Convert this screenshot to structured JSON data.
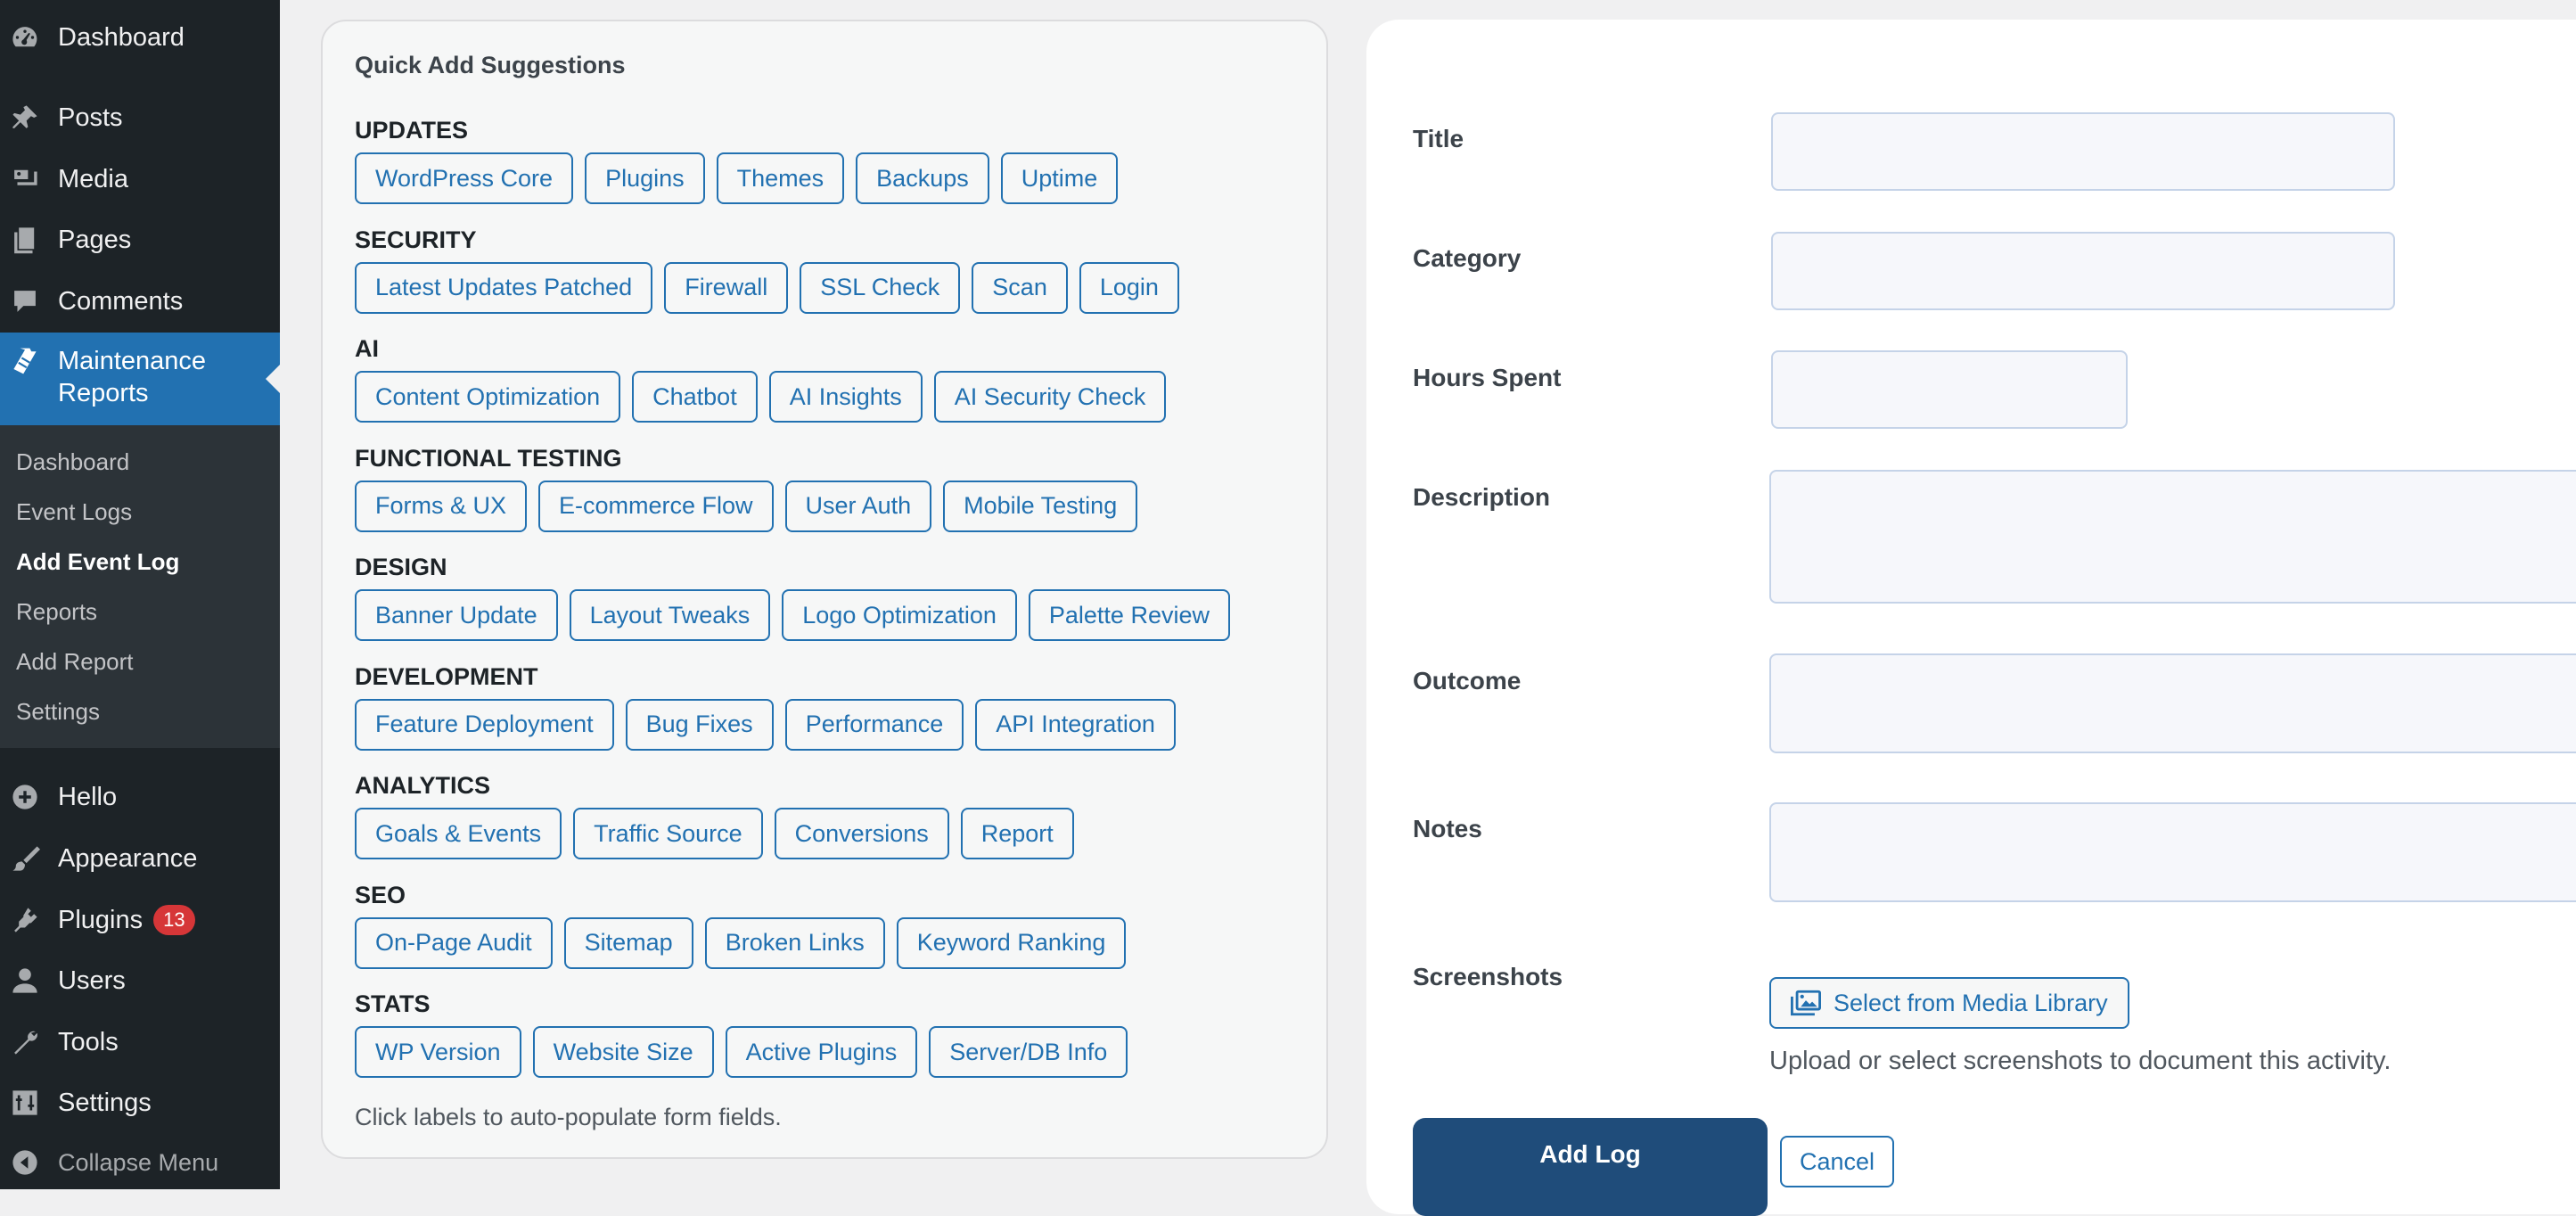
{
  "sidebar": {
    "top_items": [
      {
        "label": "Dashboard",
        "icon": "dashboard-icon"
      },
      {
        "label": "Posts",
        "icon": "pin-icon"
      },
      {
        "label": "Media",
        "icon": "media-icon"
      },
      {
        "label": "Pages",
        "icon": "pages-icon"
      },
      {
        "label": "Comments",
        "icon": "comment-icon"
      }
    ],
    "active_item": {
      "label": "Maintenance Reports",
      "icon": "clipboard-icon"
    },
    "submenu": [
      "Dashboard",
      "Event Logs",
      "Add Event Log",
      "Reports",
      "Add Report",
      "Settings"
    ],
    "submenu_current": "Add Event Log",
    "bottom_items": [
      {
        "label": "Hello",
        "icon": "plus-circle-icon"
      },
      {
        "label": "Appearance",
        "icon": "brush-icon"
      },
      {
        "label": "Plugins",
        "icon": "plugin-icon",
        "badge": "13"
      },
      {
        "label": "Users",
        "icon": "user-icon"
      },
      {
        "label": "Tools",
        "icon": "wrench-icon"
      },
      {
        "label": "Settings",
        "icon": "settings-icon"
      }
    ],
    "collapse_label": "Collapse Menu"
  },
  "quick_add": {
    "title": "Quick Add Suggestions",
    "groups": [
      {
        "label": "UPDATES",
        "chips": [
          "WordPress Core",
          "Plugins",
          "Themes",
          "Backups",
          "Uptime"
        ]
      },
      {
        "label": "SECURITY",
        "chips": [
          "Latest Updates Patched",
          "Firewall",
          "SSL Check",
          "Scan",
          "Login"
        ]
      },
      {
        "label": "AI",
        "chips": [
          "Content Optimization",
          "Chatbot",
          "AI Insights",
          "AI Security Check"
        ]
      },
      {
        "label": "FUNCTIONAL TESTING",
        "chips": [
          "Forms & UX",
          "E-commerce Flow",
          "User Auth",
          "Mobile Testing"
        ]
      },
      {
        "label": "DESIGN",
        "chips": [
          "Banner Update",
          "Layout Tweaks",
          "Logo Optimization",
          "Palette Review"
        ]
      },
      {
        "label": "DEVELOPMENT",
        "chips": [
          "Feature Deployment",
          "Bug Fixes",
          "Performance",
          "API Integration"
        ]
      },
      {
        "label": "ANALYTICS",
        "chips": [
          "Goals & Events",
          "Traffic Source",
          "Conversions",
          "Report"
        ]
      },
      {
        "label": "SEO",
        "chips": [
          "On-Page Audit",
          "Sitemap",
          "Broken Links",
          "Keyword Ranking"
        ]
      },
      {
        "label": "STATS",
        "chips": [
          "WP Version",
          "Website Size",
          "Active Plugins",
          "Server/DB Info"
        ]
      }
    ],
    "help": "Click labels to auto-populate form fields."
  },
  "form": {
    "title_label": "Title",
    "title_value": "",
    "category_label": "Category",
    "category_value": "",
    "hours_label": "Hours Spent",
    "hours_value": "",
    "description_label": "Description",
    "outcome_label": "Outcome",
    "notes_label": "Notes",
    "screenshots_label": "Screenshots",
    "media_button": "Select from Media Library",
    "screenshots_help": "Upload or select screenshots to document this activity.",
    "submit_button": "Add Log",
    "cancel_button": "Cancel"
  },
  "colors": {
    "sidebar_bg": "#1d2327",
    "accent": "#2271b1",
    "primary_button": "#1f4c7a",
    "badge": "#d63638"
  }
}
